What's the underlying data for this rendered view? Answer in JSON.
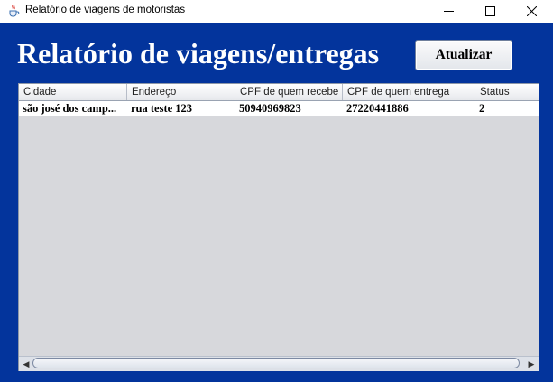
{
  "window": {
    "title": "Relatório de viagens de motoristas"
  },
  "header": {
    "title": "Relatório de viagens/entregas",
    "refresh_label": "Atualizar"
  },
  "table": {
    "columns": [
      "Cidade",
      "Endereço",
      "CPF de quem recebe",
      "CPF de quem entrega",
      "Status"
    ],
    "rows": [
      [
        "são josé dos camp...",
        "rua teste 123",
        "50940969823",
        "27220441886",
        "2"
      ]
    ]
  },
  "colors": {
    "background": "#03349c",
    "table_area": "#d7d8dc"
  },
  "icons": {
    "app": "java-cup-icon",
    "minimize": "minimize-icon",
    "maximize": "maximize-icon",
    "close": "close-icon",
    "scroll_left": "arrow-left-icon",
    "scroll_right": "arrow-right-icon"
  }
}
